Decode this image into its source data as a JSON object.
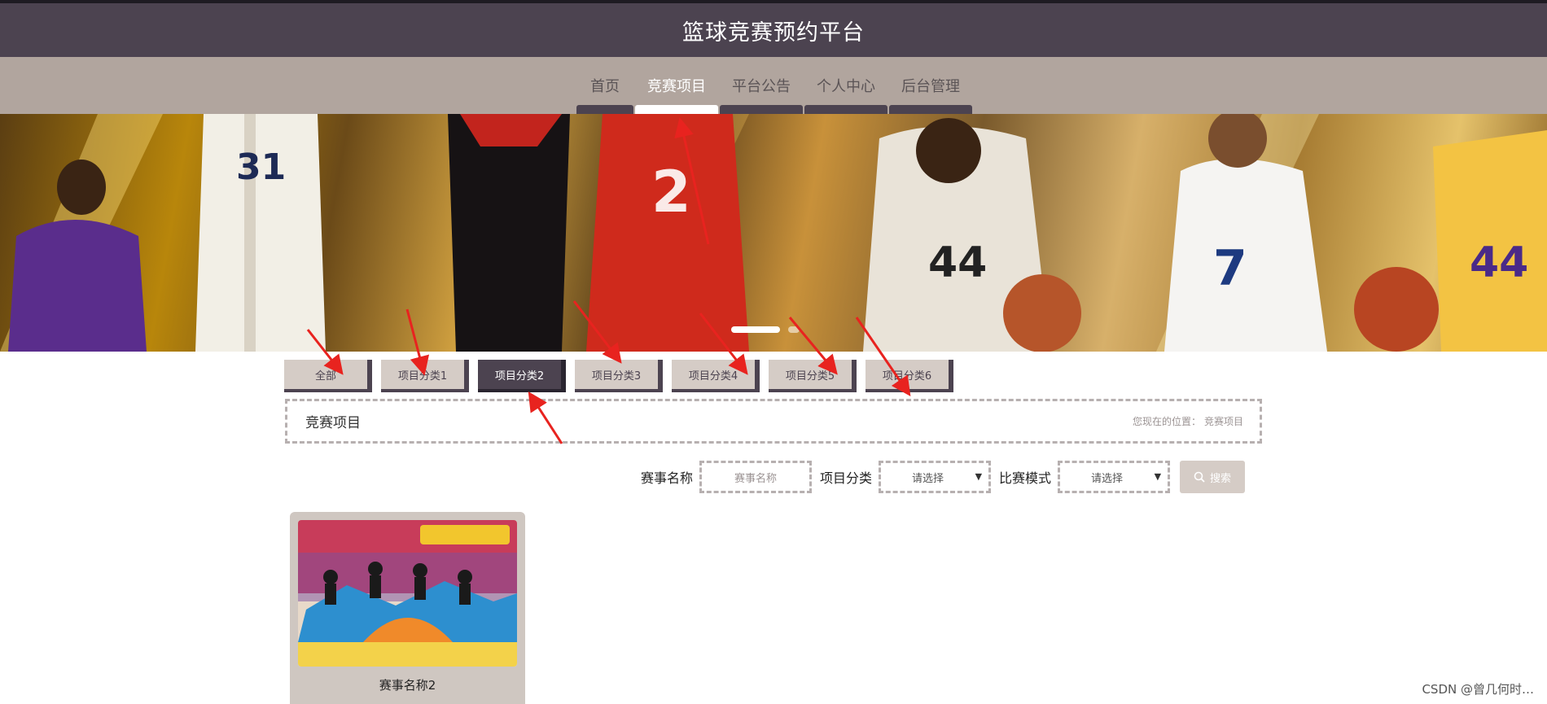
{
  "header": {
    "site_title": "篮球竞赛预约平台"
  },
  "nav": {
    "items": [
      {
        "label": "首页",
        "active": false
      },
      {
        "label": "竞赛项目",
        "active": true
      },
      {
        "label": "平台公告",
        "active": false
      },
      {
        "label": "个人中心",
        "active": false
      },
      {
        "label": "后台管理",
        "active": false
      }
    ]
  },
  "banner": {
    "slides": 2,
    "active_slide": 1,
    "jersey_numbers": [
      "31",
      "2",
      "44",
      "7",
      "44"
    ]
  },
  "tabs": {
    "items": [
      {
        "label": "全部",
        "active": false
      },
      {
        "label": "项目分类1",
        "active": false
      },
      {
        "label": "项目分类2",
        "active": true
      },
      {
        "label": "项目分类3",
        "active": false
      },
      {
        "label": "项目分类4",
        "active": false
      },
      {
        "label": "项目分类5",
        "active": false
      },
      {
        "label": "项目分类6",
        "active": false
      }
    ]
  },
  "breadcrumb": {
    "title": "竞赛项目",
    "location_prefix": "您现在的位置：",
    "location_current": "竞赛项目"
  },
  "search": {
    "name_label": "赛事名称",
    "name_placeholder": "赛事名称",
    "category_label": "项目分类",
    "category_value": "请选择",
    "mode_label": "比赛模式",
    "mode_value": "请选择",
    "button_label": "搜索"
  },
  "cards": [
    {
      "name": "赛事名称2"
    }
  ],
  "watermark": "CSDN @曾几何时…",
  "colors": {
    "header_bg": "#4c4350",
    "nav_bg": "#b1a59e",
    "annotation": "#e8231f",
    "tab_bg": "#d5ccc6"
  }
}
